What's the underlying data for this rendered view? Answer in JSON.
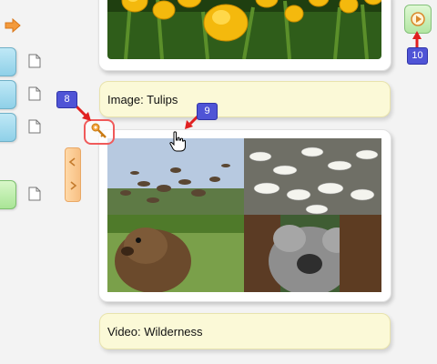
{
  "captions": {
    "image_tulips": "Image: Tulips",
    "video_wilderness": "Video: Wilderness"
  },
  "badges": {
    "b8": "8",
    "b9": "9",
    "b10": "10"
  },
  "colors": {
    "badge": "#4f54d6",
    "arrow": "#e02020",
    "caption_bg": "#fbf9d7",
    "play_green": "#b3e6a2",
    "tab_blue": "#8fd0e8"
  },
  "icons": [
    "orange-arrow-icon",
    "document-icon",
    "chevron-left-icon",
    "chevron-right-icon",
    "play-icon",
    "key-icon",
    "hand-cursor-icon"
  ]
}
